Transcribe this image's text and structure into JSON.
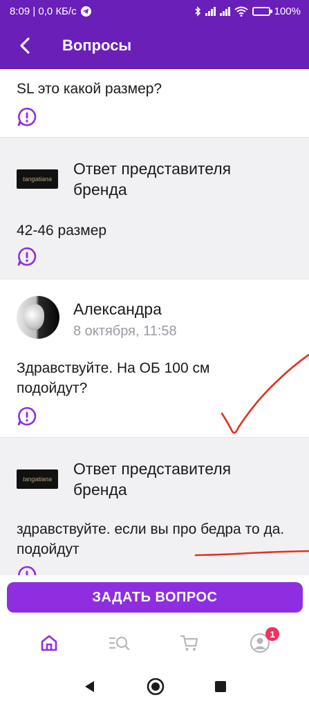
{
  "status_bar": {
    "time_speed": "8:09 | 0,0 КБ/с",
    "battery": "100%"
  },
  "app_bar": {
    "title": "Вопросы"
  },
  "feed": {
    "question1": {
      "text": "SL  это какой размер?"
    },
    "answer1": {
      "author": "Ответ представителя бренда",
      "text": "42-46 размер",
      "logo_text": "tangatiana"
    },
    "question2": {
      "author": "Александра",
      "date": "8 октября, 11:58",
      "text": "Здравствуйте. На ОБ 100 см подойдут?"
    },
    "answer2": {
      "author": "Ответ представителя бренда",
      "text": "здравствуйте. если вы про бедра то да. подойдут",
      "logo_text": "tangatiana"
    }
  },
  "ask_button": {
    "label": "ЗАДАТЬ ВОПРОС"
  },
  "tab_bar": {
    "items": [
      "home-icon",
      "catalog-search-icon",
      "cart-icon",
      "profile-icon"
    ],
    "profile_badge": "1"
  },
  "colors": {
    "brand_purple": "#6a1fb8",
    "button_purple": "#8e2ee0",
    "annotation_red": "#e0311f"
  }
}
